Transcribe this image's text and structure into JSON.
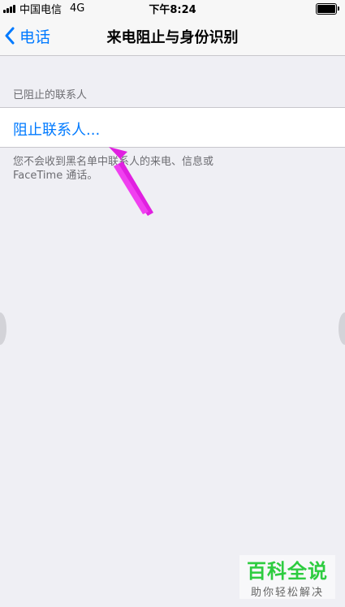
{
  "status_bar": {
    "carrier": "中国电信",
    "network": "4G",
    "time": "下午8:24"
  },
  "nav": {
    "back_label": "电话",
    "title": "来电阻止与身份识别"
  },
  "blocked": {
    "section_header": "已阻止的联系人",
    "block_contact_label": "阻止联系人...",
    "footer_line1": "您不会收到黑名单中联系人的来电、信息或",
    "footer_line2": "FaceTime 通话。"
  },
  "watermark": {
    "title": "百科全说",
    "subtitle": "助你轻松解决"
  },
  "colors": {
    "accent": "#007aff",
    "arrow": "#e020e0",
    "watermark_green": "#2ecc40"
  },
  "icons": [
    "chevron-left-icon",
    "signal-icon",
    "battery-icon",
    "arrow-annotation"
  ]
}
